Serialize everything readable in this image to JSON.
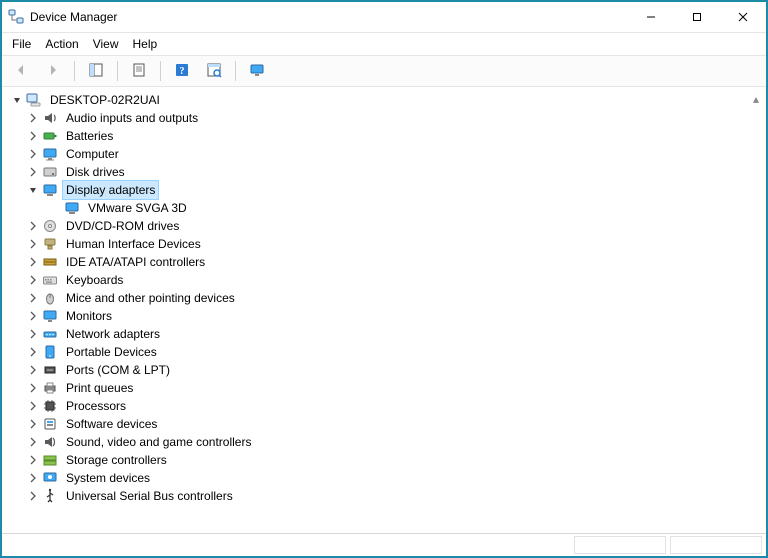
{
  "window": {
    "title": "Device Manager"
  },
  "menu": {
    "items": [
      "File",
      "Action",
      "View",
      "Help"
    ]
  },
  "toolbar": {
    "buttons": [
      {
        "name": "back-button",
        "icon": "arrow-left-icon",
        "enabled": false
      },
      {
        "name": "forward-button",
        "icon": "arrow-right-icon",
        "enabled": false
      },
      {
        "name": "separator"
      },
      {
        "name": "show-hide-tree-button",
        "icon": "tree-pane-icon",
        "enabled": true
      },
      {
        "name": "separator"
      },
      {
        "name": "properties-button",
        "icon": "properties-icon",
        "enabled": true
      },
      {
        "name": "separator"
      },
      {
        "name": "help-button",
        "icon": "help-icon",
        "enabled": true
      },
      {
        "name": "scan-hardware-button",
        "icon": "scan-icon",
        "enabled": true
      },
      {
        "name": "separator"
      },
      {
        "name": "monitor-toolbar-button",
        "icon": "monitor-toolbtn-icon",
        "enabled": true
      }
    ]
  },
  "tree": {
    "root": {
      "label": "DESKTOP-02R2UAI",
      "icon": "computer-icon",
      "expanded": true
    },
    "categories": [
      {
        "label": "Audio inputs and outputs",
        "icon": "audio-icon",
        "expanded": false
      },
      {
        "label": "Batteries",
        "icon": "battery-icon",
        "expanded": false
      },
      {
        "label": "Computer",
        "icon": "desktop-icon",
        "expanded": false
      },
      {
        "label": "Disk drives",
        "icon": "disk-icon",
        "expanded": false
      },
      {
        "label": "Display adapters",
        "icon": "display-icon",
        "expanded": true,
        "selected": true,
        "children": [
          {
            "label": "VMware SVGA 3D",
            "icon": "display-icon"
          }
        ]
      },
      {
        "label": "DVD/CD-ROM drives",
        "icon": "optical-icon",
        "expanded": false
      },
      {
        "label": "Human Interface Devices",
        "icon": "hid-icon",
        "expanded": false
      },
      {
        "label": "IDE ATA/ATAPI controllers",
        "icon": "ide-icon",
        "expanded": false
      },
      {
        "label": "Keyboards",
        "icon": "keyboard-icon",
        "expanded": false
      },
      {
        "label": "Mice and other pointing devices",
        "icon": "mouse-icon",
        "expanded": false
      },
      {
        "label": "Monitors",
        "icon": "monitor-icon",
        "expanded": false
      },
      {
        "label": "Network adapters",
        "icon": "network-icon",
        "expanded": false
      },
      {
        "label": "Portable Devices",
        "icon": "portable-icon",
        "expanded": false
      },
      {
        "label": "Ports (COM & LPT)",
        "icon": "ports-icon",
        "expanded": false
      },
      {
        "label": "Print queues",
        "icon": "printer-icon",
        "expanded": false
      },
      {
        "label": "Processors",
        "icon": "processor-icon",
        "expanded": false
      },
      {
        "label": "Software devices",
        "icon": "software-icon",
        "expanded": false
      },
      {
        "label": "Sound, video and game controllers",
        "icon": "sound-icon",
        "expanded": false
      },
      {
        "label": "Storage controllers",
        "icon": "storage-icon",
        "expanded": false
      },
      {
        "label": "System devices",
        "icon": "system-icon",
        "expanded": false
      },
      {
        "label": "Universal Serial Bus controllers",
        "icon": "usb-icon",
        "expanded": false
      }
    ]
  }
}
